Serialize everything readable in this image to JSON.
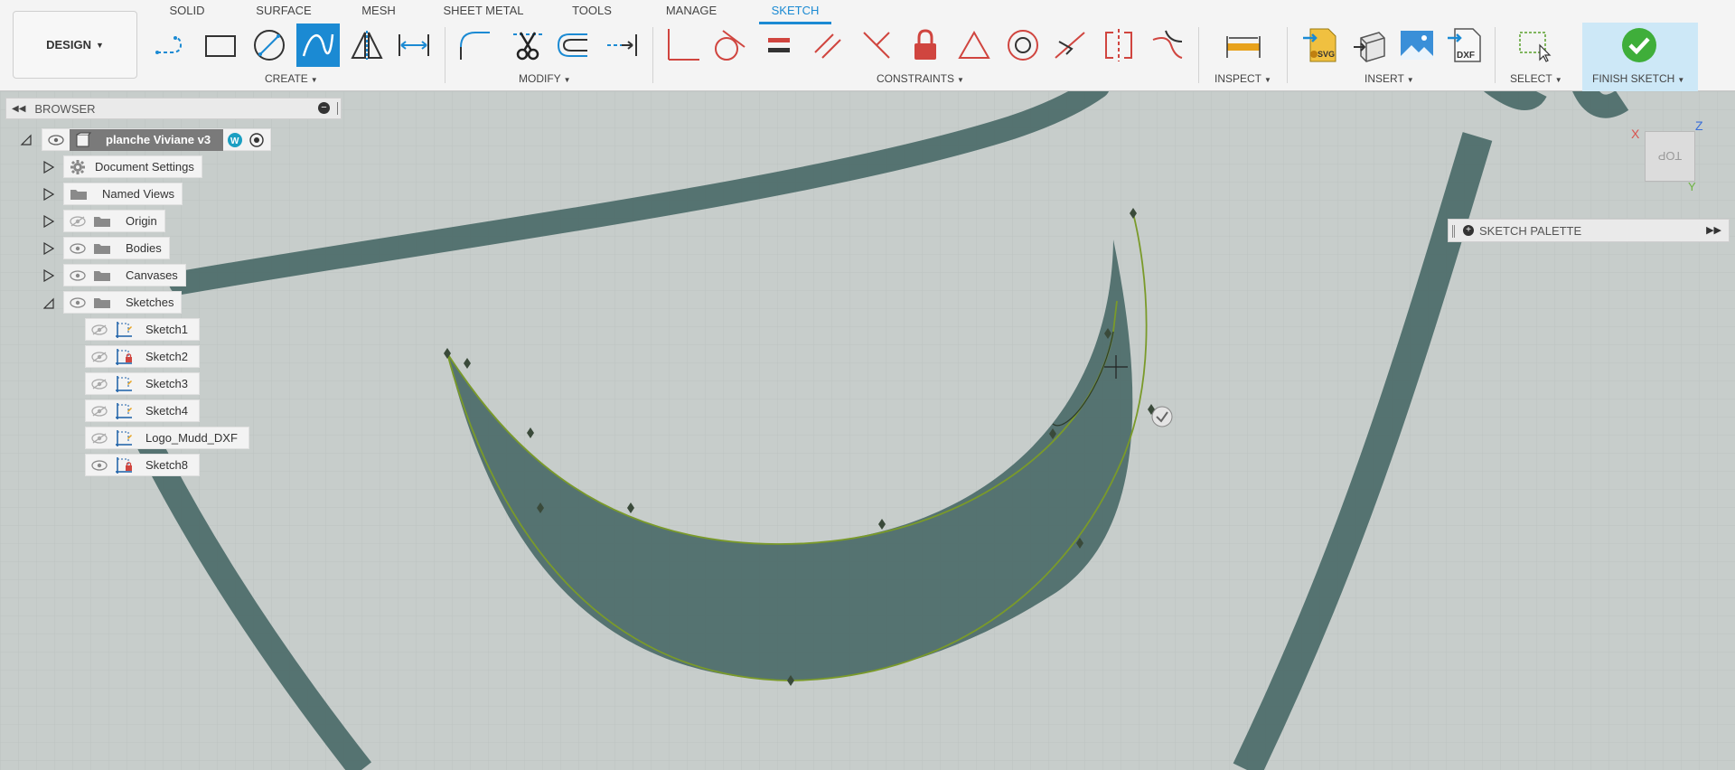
{
  "workspace": {
    "label": "DESIGN"
  },
  "tabs": [
    {
      "label": "SOLID",
      "active": false
    },
    {
      "label": "SURFACE",
      "active": false
    },
    {
      "label": "MESH",
      "active": false
    },
    {
      "label": "SHEET METAL",
      "active": false
    },
    {
      "label": "TOOLS",
      "active": false
    },
    {
      "label": "MANAGE",
      "active": false
    },
    {
      "label": "SKETCH",
      "active": true
    }
  ],
  "groups": {
    "create": "CREATE",
    "modify": "MODIFY",
    "constraints": "CONSTRAINTS",
    "inspect": "INSPECT",
    "insert": "INSERT",
    "select": "SELECT",
    "finish": "FINISH SKETCH"
  },
  "tools": {
    "create": [
      "line-icon",
      "rectangle-icon",
      "circle-icon",
      "spline-icon",
      "mirror-icon",
      "dimension-icon"
    ],
    "modify": [
      "fillet-icon",
      "trim-icon",
      "offset-icon",
      "extend-icon"
    ],
    "constraints": [
      "coincident-icon",
      "tangent-icon",
      "equal-icon",
      "parallel-icon",
      "perpendicular-icon",
      "fix-icon",
      "midpoint-icon",
      "concentric-icon",
      "collinear-icon",
      "symmetry-icon",
      "curvature-icon"
    ],
    "inspect": [
      "measure-icon"
    ],
    "insert": [
      "insert-svg-icon",
      "insert-mesh-icon",
      "canvas-image-icon",
      "insert-dxf-icon"
    ],
    "select": [
      "window-select-icon"
    ],
    "finish": [
      "finish-check-icon"
    ]
  },
  "insert_badges": {
    "svg": "SVG",
    "dxf": "DXF"
  },
  "browser": {
    "title": "BROWSER",
    "root": "planche Viviane v3",
    "items": [
      {
        "label": "Document Settings",
        "icon": "gear-icon"
      },
      {
        "label": "Named Views",
        "icon": "folder-icon"
      },
      {
        "label": "Origin",
        "icon": "folder-icon",
        "visible": false
      },
      {
        "label": "Bodies",
        "icon": "folder-icon",
        "visible": true
      },
      {
        "label": "Canvases",
        "icon": "folder-icon",
        "visible": true
      },
      {
        "label": "Sketches",
        "icon": "folder-icon",
        "visible": true,
        "expanded": true
      }
    ],
    "sketches": [
      {
        "label": "Sketch1",
        "visible": false,
        "locked": false
      },
      {
        "label": "Sketch2",
        "visible": false,
        "locked": true
      },
      {
        "label": "Sketch3",
        "visible": false,
        "locked": false
      },
      {
        "label": "Sketch4",
        "visible": false,
        "locked": false
      },
      {
        "label": "Logo_Mudd_DXF",
        "visible": false,
        "locked": false
      },
      {
        "label": "Sketch8",
        "visible": true,
        "locked": true
      }
    ]
  },
  "viewcube": {
    "face": "TOP",
    "x": "X",
    "y": "Y",
    "z": "Z"
  },
  "palette": {
    "title": "SKETCH PALETTE"
  },
  "colors": {
    "accent": "#1b8ad3",
    "canvas": "#c7cdcb",
    "stroke": "#4f6e6c",
    "spline": "#7a9a2a",
    "constraint_red": "#d0453f"
  }
}
